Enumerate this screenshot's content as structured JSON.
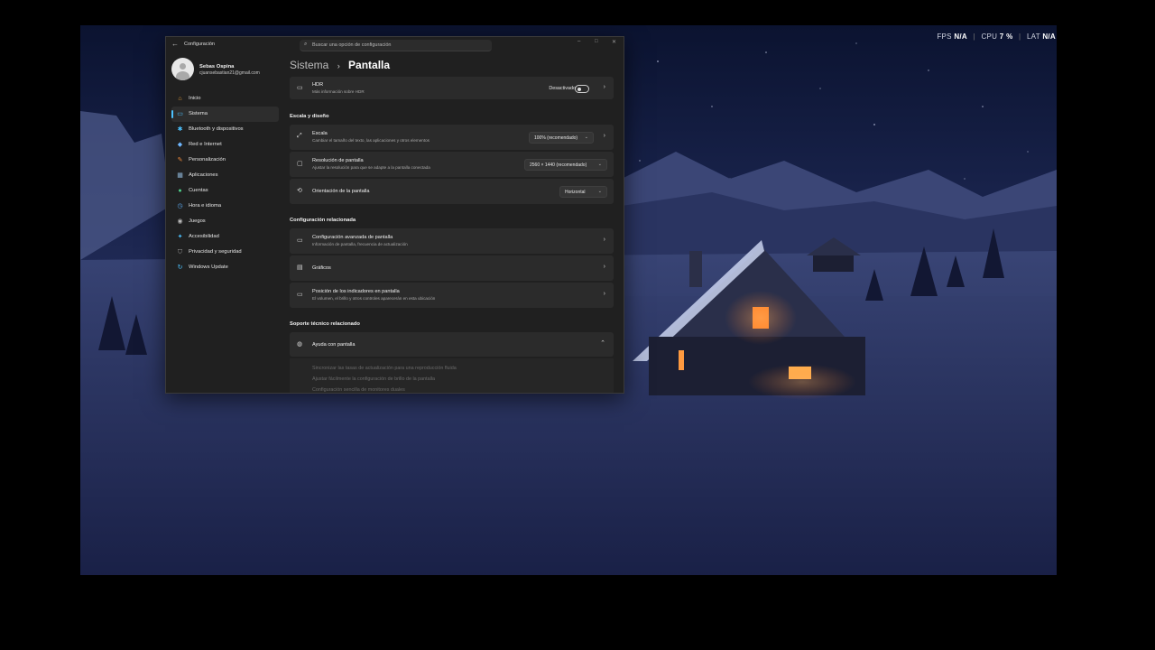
{
  "hud": {
    "fps_label": "FPS",
    "fps_value": "N/A",
    "cpu_label": "CPU",
    "cpu_value": "7 %",
    "lat_label": "LAT",
    "lat_value": "N/A"
  },
  "window": {
    "title": "Configuración",
    "search_placeholder": "Buscar una opción de configuración"
  },
  "profile": {
    "name": "Sebas Ospina",
    "email": "cjuansebastian21@gmail.com"
  },
  "sidebar": {
    "items": [
      {
        "label": "Inicio",
        "icon": "home-icon",
        "color": "#e9a13b",
        "glyph": "⌂"
      },
      {
        "label": "Sistema",
        "icon": "system-icon",
        "color": "#4cc2ff",
        "glyph": "▭"
      },
      {
        "label": "Bluetooth y dispositivos",
        "icon": "bluetooth-icon",
        "color": "#4cc2ff",
        "glyph": "✱"
      },
      {
        "label": "Red e Internet",
        "icon": "network-icon",
        "color": "#6fb7ff",
        "glyph": "◆"
      },
      {
        "label": "Personalización",
        "icon": "brush-icon",
        "color": "#f08a3c",
        "glyph": "✎"
      },
      {
        "label": "Aplicaciones",
        "icon": "apps-icon",
        "color": "#8fb6d8",
        "glyph": "▦"
      },
      {
        "label": "Cuentas",
        "icon": "accounts-icon",
        "color": "#4fd08a",
        "glyph": "●"
      },
      {
        "label": "Hora e idioma",
        "icon": "clock-globe-icon",
        "color": "#5aa9f0",
        "glyph": "◷"
      },
      {
        "label": "Juegos",
        "icon": "gamepad-icon",
        "color": "#b9b9b9",
        "glyph": "◉"
      },
      {
        "label": "Accesibilidad",
        "icon": "accessibility-icon",
        "color": "#4cc2ff",
        "glyph": "✦"
      },
      {
        "label": "Privacidad y seguridad",
        "icon": "shield-icon",
        "color": "#9a9a9a",
        "glyph": "⛉"
      },
      {
        "label": "Windows Update",
        "icon": "update-icon",
        "color": "#4cc2ff",
        "glyph": "↻"
      }
    ],
    "active_index": 1
  },
  "breadcrumb": {
    "parent": "Sistema",
    "current": "Pantalla"
  },
  "hdr": {
    "title": "HDR",
    "subtitle": "Más información sobre HDR",
    "toggle_label": "Desactivado",
    "enabled": false
  },
  "sections": {
    "scale_layout": "Escala y diseño",
    "related_config": "Configuración relacionada",
    "related_support": "Soporte técnico relacionado"
  },
  "scale": {
    "title": "Escala",
    "subtitle": "Cambiar el tamaño del texto, las aplicaciones y otros elementos",
    "value": "100% (recomendado)"
  },
  "resolution": {
    "title": "Resolución de pantalla",
    "subtitle": "Ajustar la resolución para que se adapte a la pantalla conectada",
    "value": "2560 × 1440 (recomendado)"
  },
  "orientation": {
    "title": "Orientación de la pantalla",
    "value": "Horizontal"
  },
  "advanced": {
    "title": "Configuración avanzada de pantalla",
    "subtitle": "Información de pantalla, frecuencia de actualización"
  },
  "graphics": {
    "title": "Gráficos"
  },
  "indicators": {
    "title": "Posición de los indicadores en pantalla",
    "subtitle": "El volumen, el brillo y otros controles aparecerán en esta ubicación"
  },
  "help": {
    "title": "Ayuda con pantalla",
    "links": [
      "Sincronizar las tasas de actualización para una reproducción fluida",
      "Ajustar fácilmente la configuración de brillo de la pantalla",
      "Configuración sencilla de monitores duales"
    ]
  },
  "accent_color": "#4cc2ff"
}
